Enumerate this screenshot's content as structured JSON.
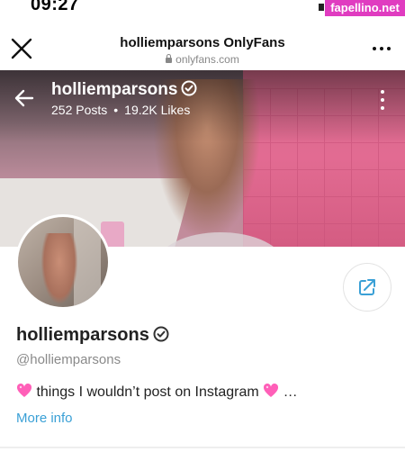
{
  "status_bar": {
    "time": "09:27"
  },
  "watermark": {
    "text": "fapellino.net"
  },
  "browser": {
    "title": "holliemparsons OnlyFans",
    "url": "onlyfans.com",
    "close_icon": "close-icon",
    "menu_icon": "more-horizontal-icon"
  },
  "cover": {
    "name": "holliemparsons",
    "posts": "252 Posts",
    "separator": "•",
    "likes": "19.2K Likes",
    "back_icon": "arrow-left-icon",
    "menu_icon": "more-vertical-icon"
  },
  "profile": {
    "name": "holliemparsons",
    "handle": "@holliemparsons",
    "bio_text": " things I wouldn’t post on Instagram ",
    "bio_ellipsis": " …",
    "more_info": "More info",
    "share_icon": "share-icon",
    "verified_icon": "verified-badge-icon"
  },
  "colors": {
    "accent": "#3aa0d6",
    "watermark_bg": "#e03cc0",
    "heart": "#ff5fb8"
  }
}
